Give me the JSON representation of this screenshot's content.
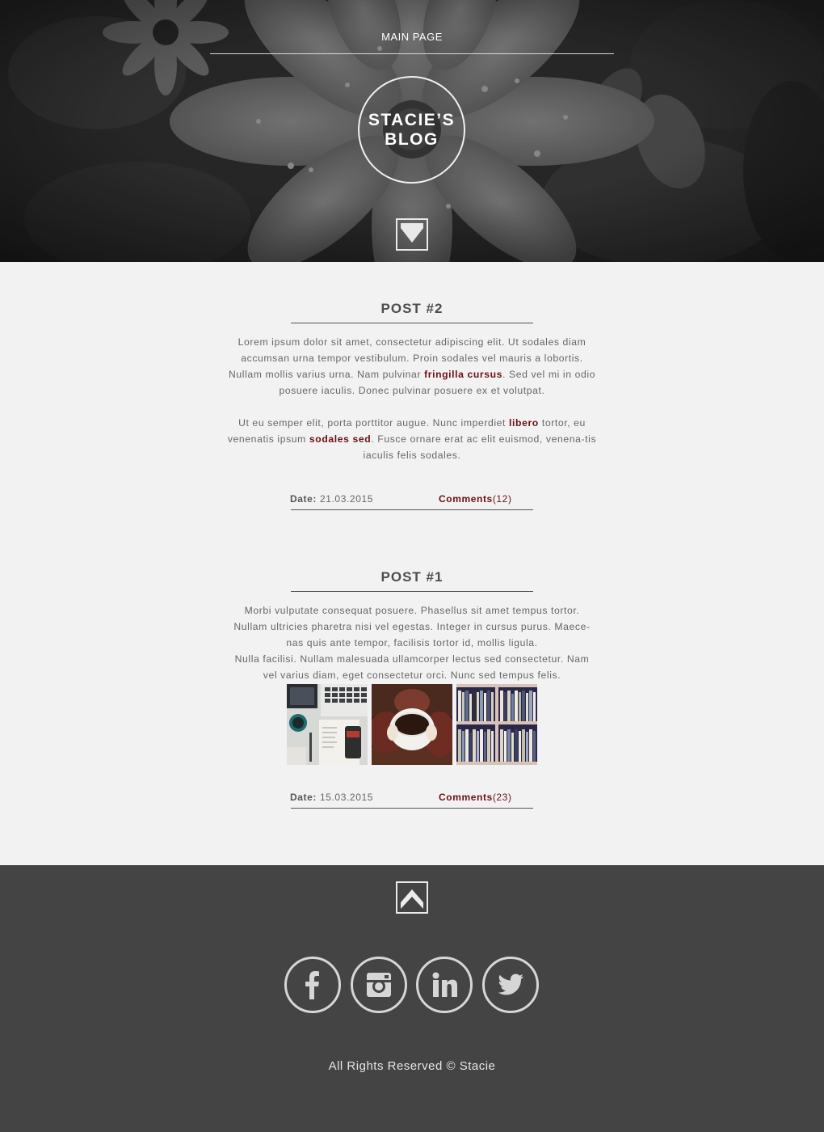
{
  "header": {
    "nav_label": "MAIN PAGE",
    "logo_line1": "STACIE’S",
    "logo_line2": "BLOG"
  },
  "posts": [
    {
      "title": "POST #2",
      "paragraphs": [
        [
          {
            "text": "Lorem ipsum dolor sit amet, consectetur adipiscing elit. Ut sodales diam accumsan urna tempor vestibulum. Proin sodales vel mauris a lobortis. Nullam mollis varius urna. Nam pulvinar ",
            "bold": false
          },
          {
            "text": "fringilla cursus",
            "bold": true
          },
          {
            "text": ". Sed vel mi in odio posuere iaculis. Donec pulvinar posuere ex et volutpat.",
            "bold": false
          }
        ],
        [
          {
            "text": "Ut eu semper elit, porta porttitor augue. Nunc imperdiet ",
            "bold": false
          },
          {
            "text": "libero",
            "bold": true
          },
          {
            "text": " tortor, eu venenatis ipsum ",
            "bold": false
          },
          {
            "text": "sodales sed",
            "bold": true
          },
          {
            "text": ". Fusce ornare erat ac elit euismod, venena-tis iaculis felis sodales.",
            "bold": false
          }
        ]
      ],
      "date_label": "Date:",
      "date": "21.03.2015",
      "comments_label": "Comments",
      "comments_count": "(12)"
    },
    {
      "title": "POST #1",
      "paragraphs": [
        [
          {
            "text": "Morbi vulputate consequat posuere. Phasellus sit amet tempus tortor. Nullam ultricies pharetra nisi vel egestas. Integer in cursus purus. Maece-nas quis ante tempor, facilisis tortor id, mollis ligula.",
            "bold": false
          }
        ],
        [
          {
            "text": "Nulla facilisi. Nullam malesuada ullamcorper lectus sed consectetur. Nam vel varius diam, eget consectetur orci. Nunc sed tempus felis.",
            "bold": false
          }
        ]
      ],
      "date_label": "Date:",
      "date": "15.03.2015",
      "comments_label": "Comments",
      "comments_count": "(23)"
    }
  ],
  "footer": {
    "social_icons": [
      "facebook-icon",
      "instagram-icon",
      "linkedin-icon",
      "twitter-icon"
    ],
    "copyright": "All Rights Reserved © Stacie"
  },
  "colors": {
    "accent": "#6b0f14",
    "page_bg": "#f2f2f2",
    "footer_bg": "#444444"
  }
}
